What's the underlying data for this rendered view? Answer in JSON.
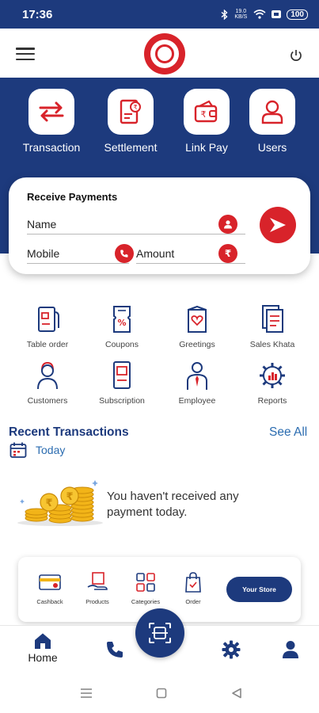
{
  "status_bar": {
    "time": "17:36",
    "network_speed": "19.0 KB/S",
    "battery": "100"
  },
  "header": {
    "logo_icon": "emblem-logo",
    "menu_icon": "hamburger-menu-icon",
    "power_icon": "power-icon"
  },
  "quick_actions": [
    {
      "label": "Transaction",
      "icon": "transaction-arrows-icon"
    },
    {
      "label": "Settlement",
      "icon": "settlement-doc-icon"
    },
    {
      "label": "Link Pay",
      "icon": "wallet-rupee-icon"
    },
    {
      "label": "Users",
      "icon": "user-icon"
    }
  ],
  "receive_payments": {
    "title": "Receive Payments",
    "name_label": "Name",
    "mobile_label": "Mobile",
    "amount_label": "Amount",
    "currency_symbol": "₹"
  },
  "services": [
    {
      "label": "Table order",
      "icon": "table-order-icon"
    },
    {
      "label": "Coupons",
      "icon": "coupon-icon"
    },
    {
      "label": "Greetings",
      "icon": "greeting-card-icon"
    },
    {
      "label": "Sales Khata",
      "icon": "ledger-icon"
    },
    {
      "label": "Customers",
      "icon": "customer-icon"
    },
    {
      "label": "Subscription",
      "icon": "subscription-icon"
    },
    {
      "label": "Employee",
      "icon": "employee-icon"
    },
    {
      "label": "Reports",
      "icon": "reports-gear-icon"
    }
  ],
  "recent": {
    "title": "Recent Transactions",
    "see_all": "See All",
    "period": "Today",
    "empty_message": "You haven't received any payment today."
  },
  "store_bar": {
    "items": [
      {
        "label": "Cashback",
        "icon": "cashback-card-icon"
      },
      {
        "label": "Products",
        "icon": "products-box-icon"
      },
      {
        "label": "Categories",
        "icon": "categories-grid-icon"
      },
      {
        "label": "Order",
        "icon": "order-bag-icon"
      }
    ],
    "button_label": "Your Store"
  },
  "bottom_nav": {
    "home_label": "Home"
  },
  "colors": {
    "primary_blue": "#1d3a7d",
    "accent_red": "#d8232a",
    "link_blue": "#2b6cb0"
  }
}
